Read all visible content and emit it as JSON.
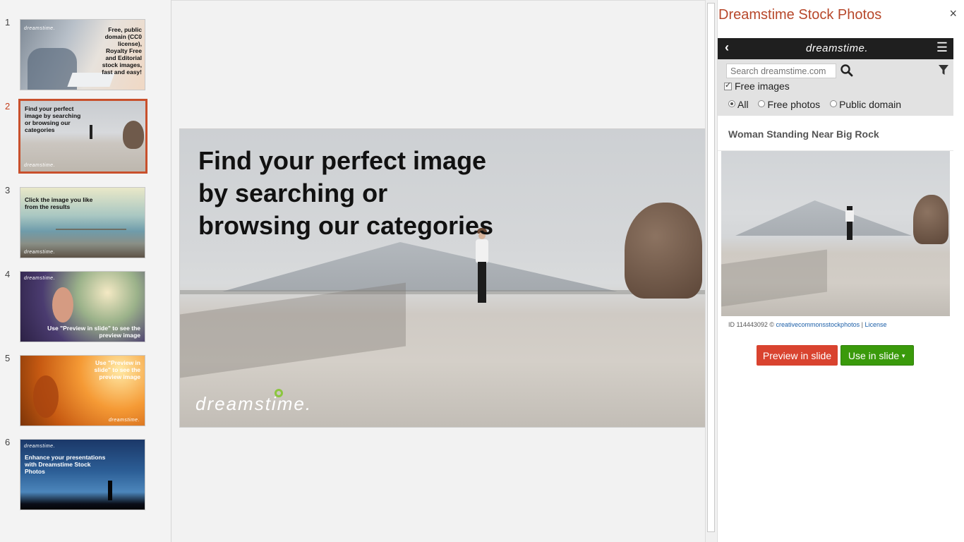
{
  "thumbnails": [
    {
      "number": "1",
      "text": "Free, public domain (CC0 license), Royalty Free and Editorial stock images, fast and easy!",
      "logo": "dreamstime."
    },
    {
      "number": "2",
      "text": "Find your perfect image by searching or browsing our categories",
      "logo": "dreamstime."
    },
    {
      "number": "3",
      "text": "Click the image you like from the results",
      "logo": "dreamstime."
    },
    {
      "number": "4",
      "text": "Use \"Preview in slide\" to see the preview image",
      "logo": "dreamstime."
    },
    {
      "number": "5",
      "text": "Use \"Preview in slide\" to see the preview image",
      "logo": "dreamstime."
    },
    {
      "number": "6",
      "text": "Enhance your presentations with Dreamstime Stock Photos",
      "logo": "dreamstime."
    }
  ],
  "slide": {
    "title": "Find your perfect image by searching or browsing our categories",
    "logo": "dreamstime."
  },
  "pane": {
    "title": "Dreamstime Stock Photos",
    "close": "×",
    "brand": "dreamstime.",
    "back": "‹",
    "menu": "☰",
    "search_placeholder": "Search dreamstime.com",
    "free_images_label": "Free images",
    "radio_options": [
      "All",
      "Free photos",
      "Public domain"
    ],
    "radio_selected": "All",
    "result_title": "Woman Standing Near Big Rock",
    "result_id": "ID 114443092 ©",
    "result_author": "creativecommonsstockphotos",
    "result_sep": "|",
    "result_license": "License",
    "preview_button": "Preview in slide",
    "use_button": "Use in slide",
    "use_caret": "▼"
  },
  "colors": {
    "accent": "#b7472a",
    "active_thumb_border": "#c8502c",
    "preview_button": "#d9432f",
    "use_button": "#3a9a0b",
    "header_bar": "#1f1f1f"
  }
}
